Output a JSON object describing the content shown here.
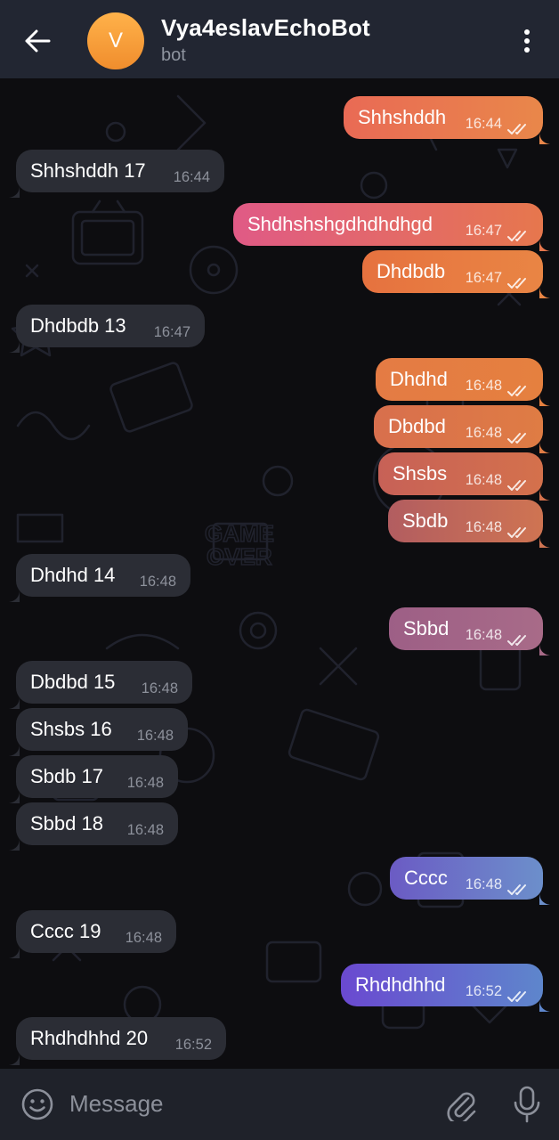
{
  "header": {
    "avatar_letter": "V",
    "title": "Vya4eslavEchoBot",
    "subtitle": "bot"
  },
  "messages": [
    {
      "dir": "out",
      "text": "Shhshddh",
      "time": "16:44"
    },
    {
      "dir": "in",
      "text": "Shhshddh 17",
      "time": "16:44"
    },
    {
      "dir": "out",
      "text": "Shdhshshgdhdhdhgd",
      "time": "16:47"
    },
    {
      "dir": "out",
      "text": "Dhdbdb",
      "time": "16:47"
    },
    {
      "dir": "in",
      "text": "Dhdbdb 13",
      "time": "16:47"
    },
    {
      "dir": "out",
      "text": "Dhdhd",
      "time": "16:48"
    },
    {
      "dir": "out",
      "text": "Dbdbd",
      "time": "16:48"
    },
    {
      "dir": "out",
      "text": "Shsbs",
      "time": "16:48"
    },
    {
      "dir": "out",
      "text": "Sbdb",
      "time": "16:48"
    },
    {
      "dir": "in",
      "text": "Dhdhd 14",
      "time": "16:48"
    },
    {
      "dir": "out",
      "text": "Sbbd",
      "time": "16:48"
    },
    {
      "dir": "in",
      "text": "Dbdbd 15",
      "time": "16:48"
    },
    {
      "dir": "in",
      "text": "Shsbs 16",
      "time": "16:48"
    },
    {
      "dir": "in",
      "text": "Sbdb 17",
      "time": "16:48"
    },
    {
      "dir": "in",
      "text": "Sbbd 18",
      "time": "16:48"
    },
    {
      "dir": "out",
      "text": "Cccc",
      "time": "16:48"
    },
    {
      "dir": "in",
      "text": "Cccc 19",
      "time": "16:48"
    },
    {
      "dir": "out",
      "text": "Rhdhdhhd",
      "time": "16:52"
    },
    {
      "dir": "in",
      "text": "Rhdhdhhd 20",
      "time": "16:52"
    }
  ],
  "input": {
    "placeholder": "Message"
  },
  "colors": {
    "header_bg": "#222632",
    "incoming_bubble": "#2b2d35",
    "avatar": "#f59a34",
    "input_bar_bg": "#1f222a"
  },
  "icons": {
    "back": "arrow-left",
    "menu": "vertical-dots",
    "emoji": "smiley",
    "attach": "paperclip",
    "mic": "microphone",
    "read_receipt": "double-check"
  }
}
